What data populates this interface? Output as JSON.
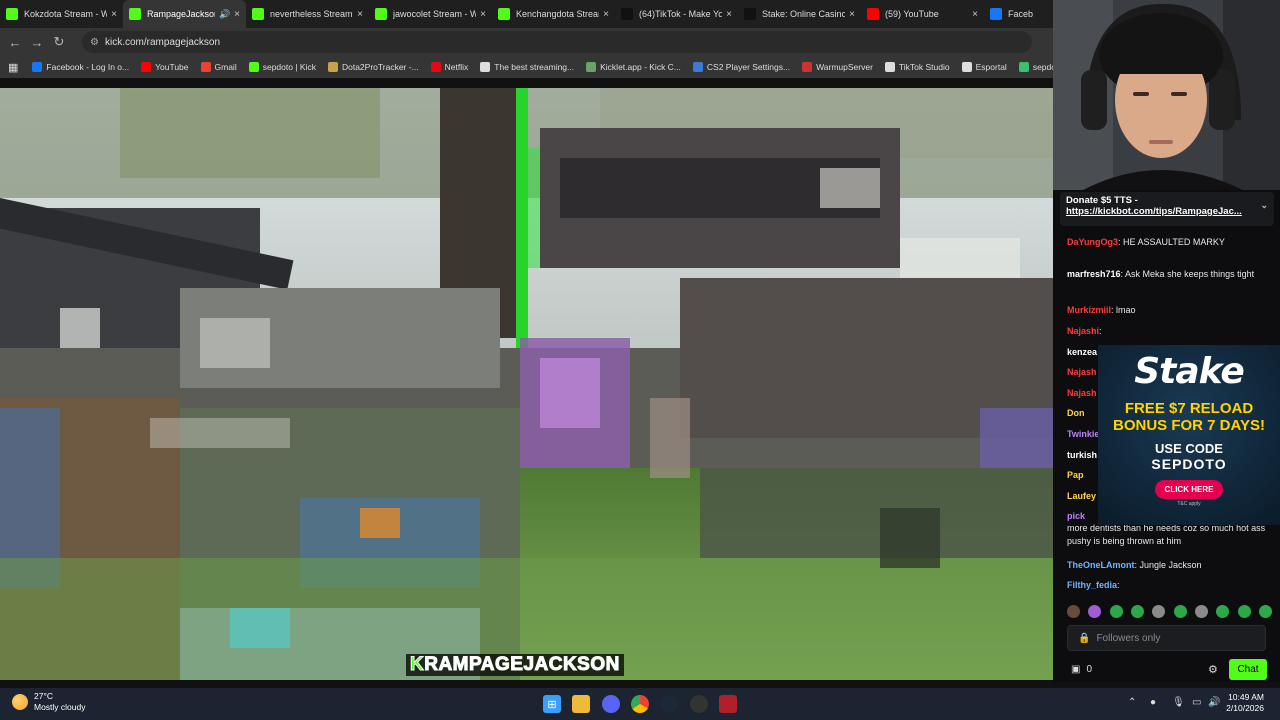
{
  "browser": {
    "tabs": [
      {
        "title": "Kokzdota Stream - W",
        "favicon": "kick",
        "color": "#53fc18"
      },
      {
        "title": "RampageJackson",
        "favicon": "kick",
        "color": "#53fc18",
        "active": true,
        "audio": true
      },
      {
        "title": "nevertheless Stream",
        "favicon": "kick",
        "color": "#53fc18"
      },
      {
        "title": "jawocolet Stream - W",
        "favicon": "kick",
        "color": "#53fc18"
      },
      {
        "title": "Kenchangdota Strean",
        "favicon": "kick",
        "color": "#53fc18"
      },
      {
        "title": "(64)TikTok - Make Yo",
        "favicon": "tiktok",
        "color": "#111111"
      },
      {
        "title": "Stake: Online Casino",
        "favicon": "stake",
        "color": "#111111"
      },
      {
        "title": "(59) YouTube",
        "favicon": "youtube",
        "color": "#ff0000"
      },
      {
        "title": "Faceb",
        "favicon": "facebook",
        "color": "#1877f2"
      }
    ],
    "url": "kick.com/rampagejackson",
    "bookmarks": [
      {
        "label": "Facebook - Log In o...",
        "color": "#1877f2"
      },
      {
        "label": "YouTube",
        "color": "#ff0000"
      },
      {
        "label": "Gmail",
        "color": "#ea4335"
      },
      {
        "label": "sepdoto | Kick",
        "color": "#53fc18"
      },
      {
        "label": "Dota2ProTracker -...",
        "color": "#c8a24a"
      },
      {
        "label": "Netflix",
        "color": "#e50914"
      },
      {
        "label": "The best streaming...",
        "color": "#dddddd"
      },
      {
        "label": "Kicklet.app - Kick C...",
        "color": "#6aa36a"
      },
      {
        "label": "CS2 Player Settings...",
        "color": "#3a7bd5"
      },
      {
        "label": "WarmupServer",
        "color": "#cc3333"
      },
      {
        "label": "TikTok Studio",
        "color": "#dddddd"
      },
      {
        "label": "Esportal",
        "color": "#dddddd"
      },
      {
        "label": "sepdotes | Weig",
        "color": "#3ac26b"
      }
    ]
  },
  "stream": {
    "streamer_name": "RAMPAGEJACKSON",
    "logo_letter": "K"
  },
  "chat": {
    "pinned_line1": "Donate $5 TTS -",
    "pinned_line2": "https://kickbot.com/tips/RampageJac...",
    "messages": [
      {
        "user": "DaYungOg3",
        "text": ": HE ASSAULTED MARKY",
        "color": "#ff3b3b"
      },
      {
        "user": "marfresh716",
        "text": ": Ask Meka she keeps things tight",
        "color": "#ffffff"
      },
      {
        "user": "Murkizmiil",
        "text": ": lmao",
        "color": "#ff3b3b"
      },
      {
        "user": "Najashi",
        "text": ":",
        "color": "#ff3b3b"
      },
      {
        "user": "kenzea",
        "text": "",
        "color": "#ffffff"
      },
      {
        "user": "Najash",
        "text": "",
        "color": "#ff3b3b"
      },
      {
        "user": "Najash",
        "text": "",
        "color": "#ff3b3b"
      },
      {
        "user": "Don",
        "text": "",
        "color": "#ffd54a"
      },
      {
        "user": "Twinkie",
        "text": "",
        "color": "#b983ff"
      },
      {
        "user": "turkish",
        "text": "",
        "color": "#ffffff"
      },
      {
        "user": "Pap",
        "text": "",
        "color": "#ffd54a"
      },
      {
        "user": "Laufey",
        "text": "",
        "color": "#ffd54a"
      },
      {
        "user": "pick",
        "text": "",
        "color": "#b983ff"
      },
      {
        "user": "",
        "text": "more dentists than he needs coz so much hot ass pushy is being thrown at him",
        "color": "#ffffff"
      },
      {
        "user": "TheOneLAmont",
        "text": ": Jungle Jackson",
        "color": "#6fb4ff"
      },
      {
        "user": "Filthy_fedia",
        "text": ":",
        "color": "#6fb4ff"
      }
    ],
    "ad": {
      "brand": "Stake",
      "headline": "FREE $7 RELOAD BONUS FOR 7 DAYS!",
      "use_code": "USE CODE",
      "code": "SEPDOTO",
      "cta": "CLICK HERE",
      "fineprint": "T&C apply"
    },
    "input_placeholder": "Followers only",
    "points": "0",
    "send_label": "Chat"
  },
  "taskbar": {
    "temperature": "27°C",
    "weather": "Mostly cloudy",
    "time": "10:49 AM",
    "date": "2/10/2026"
  }
}
